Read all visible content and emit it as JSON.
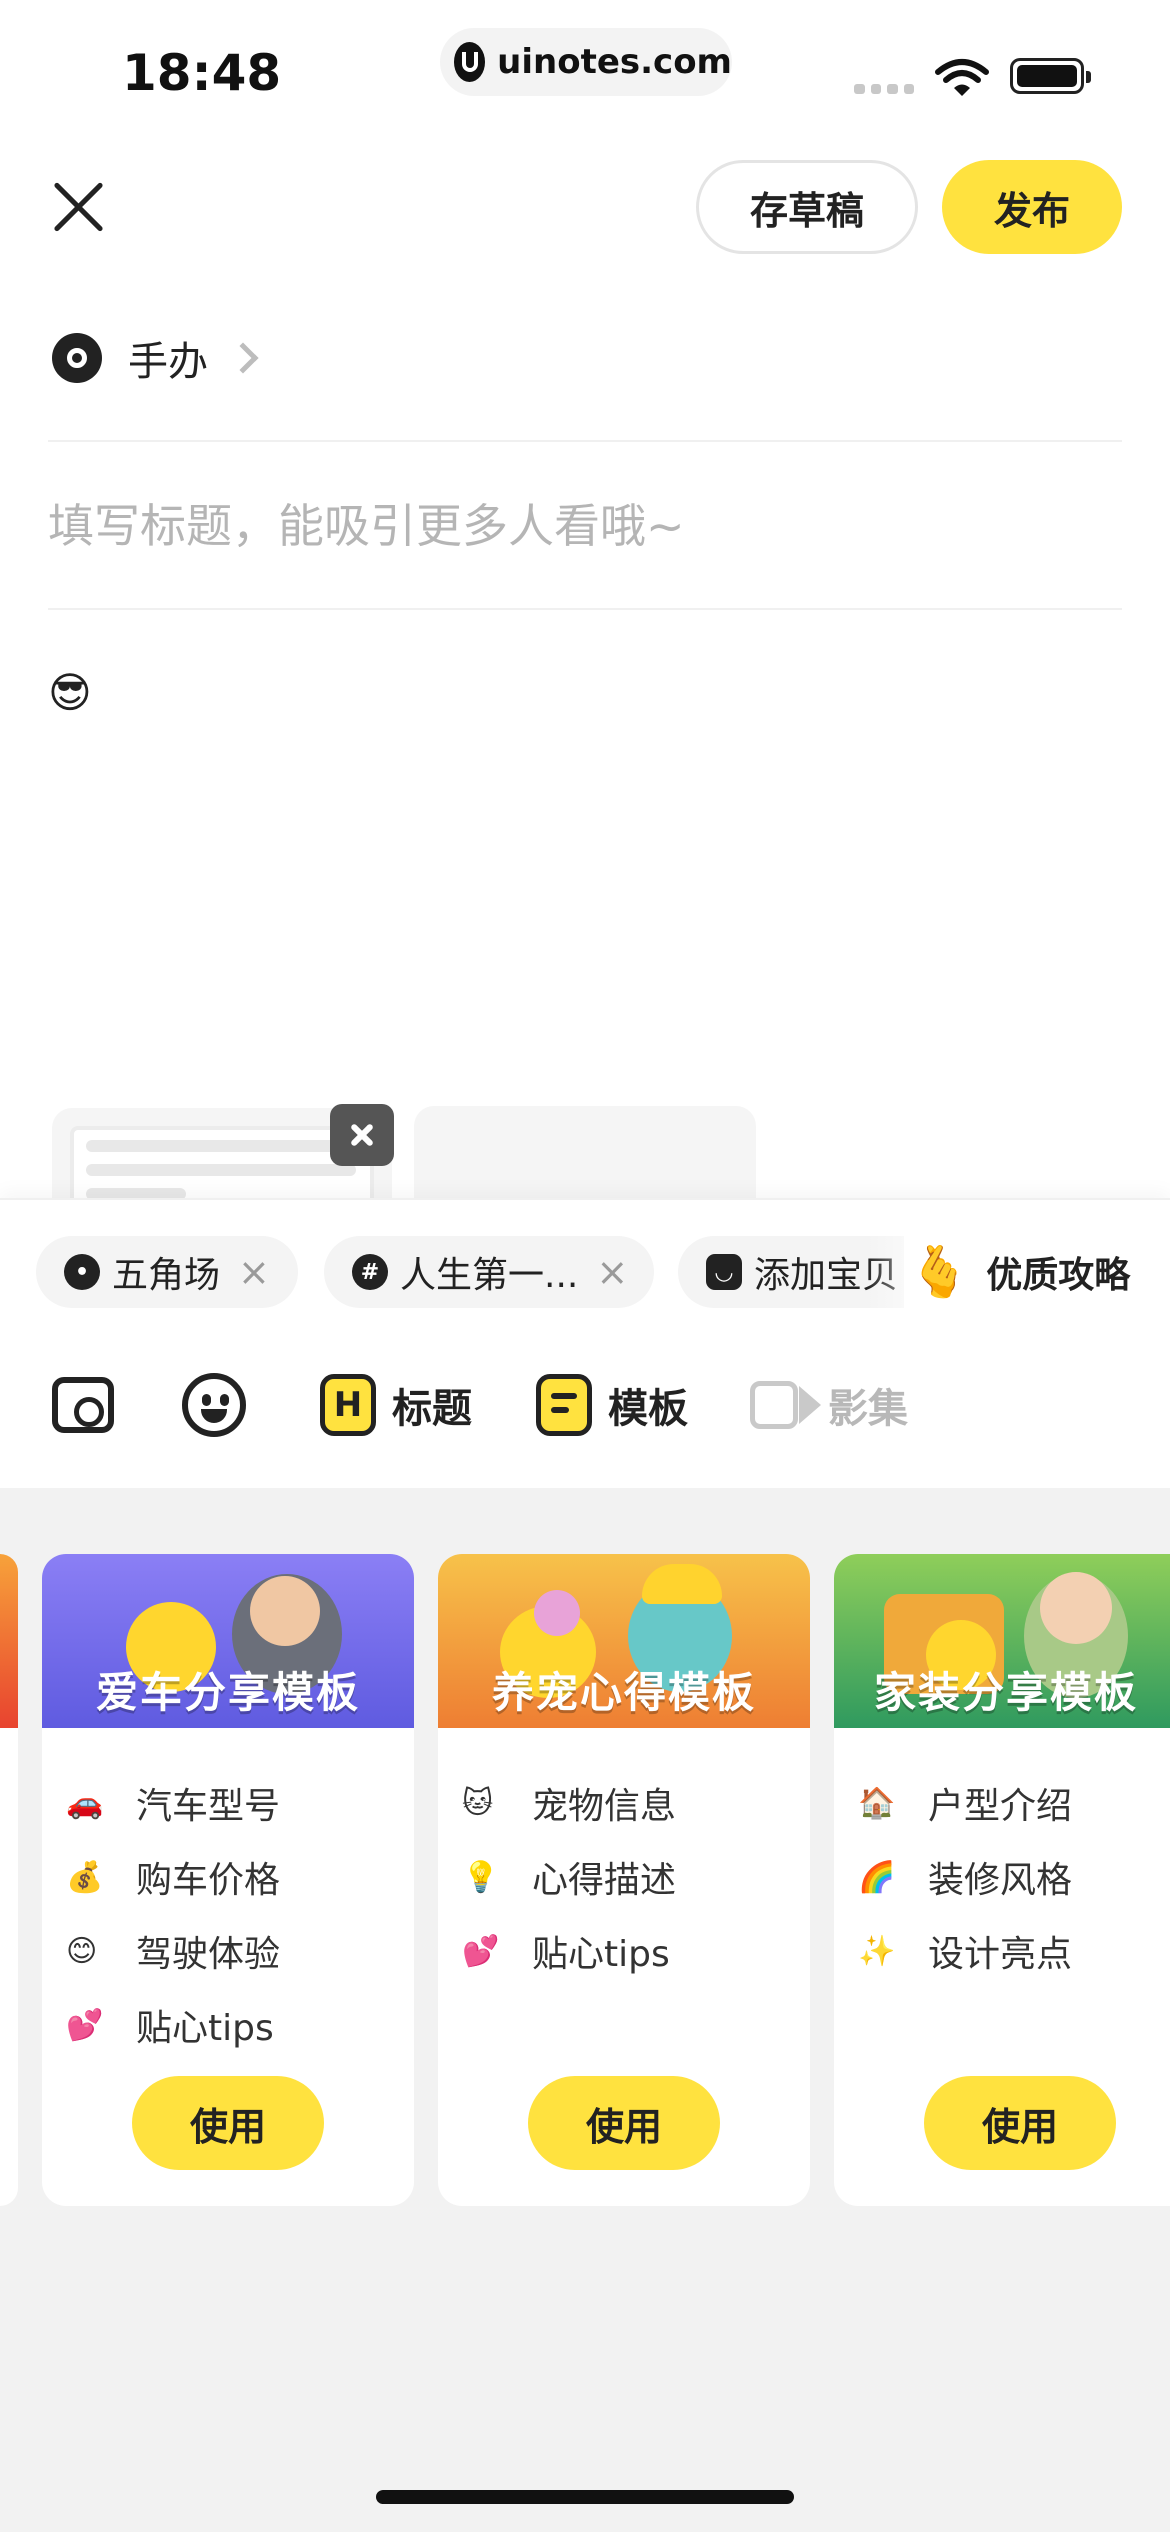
{
  "status_bar": {
    "time": "18:48",
    "url": "uinotes.com"
  },
  "header": {
    "draft_label": "存草稿",
    "publish_label": "发布"
  },
  "category": {
    "label": "手办"
  },
  "editor": {
    "title_placeholder": "填写标题，能吸引更多人看哦~",
    "body_emoji": "😎"
  },
  "tags": [
    {
      "label": "五角场",
      "icon": "location-icon"
    },
    {
      "label": "人生第一...",
      "icon": "hashtag-icon"
    },
    {
      "label": "添加宝贝",
      "icon": "shopping-bag-icon"
    }
  ],
  "promo": {
    "emoji": "🫰",
    "label": "优质攻略"
  },
  "toolbar": {
    "photo_icon": "photo-icon",
    "emoji_icon": "emoji-icon",
    "title_label": "标题",
    "template_label": "模板",
    "video_label": "影集"
  },
  "templates": [
    {
      "title": "爱车分享模板",
      "items": [
        {
          "emoji": "🚗",
          "label": "汽车型号"
        },
        {
          "emoji": "💰",
          "label": "购车价格"
        },
        {
          "emoji": "😊",
          "label": "驾驶体验"
        },
        {
          "emoji": "💕",
          "label": "贴心tips"
        }
      ],
      "button": "使用"
    },
    {
      "title": "养宠心得模板",
      "items": [
        {
          "emoji": "🐱",
          "label": "宠物信息"
        },
        {
          "emoji": "💡",
          "label": "心得描述"
        },
        {
          "emoji": "💕",
          "label": "贴心tips"
        }
      ],
      "button": "使用"
    },
    {
      "title": "家装分享模板",
      "items": [
        {
          "emoji": "🏠",
          "label": "户型介绍"
        },
        {
          "emoji": "🌈",
          "label": "装修风格"
        },
        {
          "emoji": "✨",
          "label": "设计亮点"
        }
      ],
      "button": "使用"
    }
  ],
  "colors": {
    "accent": "#ffe23f",
    "template_1_banner": "#7b74ee",
    "template_2_banner": "#f39a3c",
    "template_3_banner": "#3ea36d"
  }
}
